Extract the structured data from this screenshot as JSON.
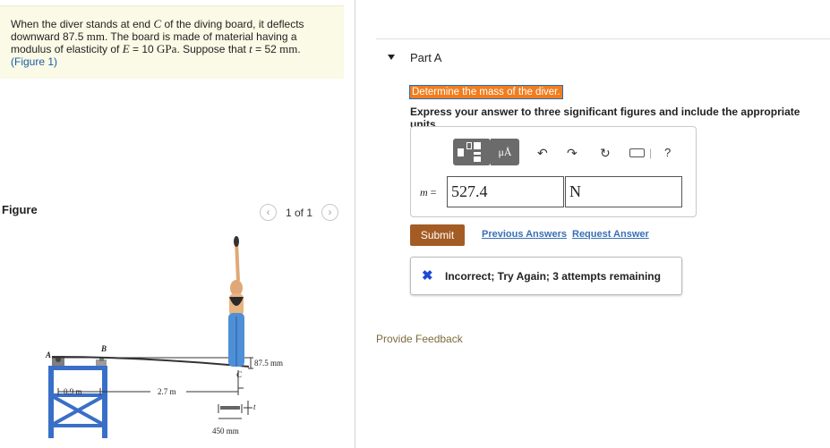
{
  "problem": {
    "line1_pre": "When the diver stands at end ",
    "line1_var": "C",
    "line1_post": " of the diving board, it deflects",
    "line2_pre": "downward 87.5 ",
    "line2_unit": "mm",
    "line2_post": ". The board is made of material having a",
    "line3_pre": "modulus of elasticity of ",
    "line3_var": "E",
    "line3_mid": " = 10 ",
    "line3_unit": "GPa",
    "line3_post": ". Suppose that ",
    "line3_var2": "t",
    "line3_post2": " = 52 ",
    "line3_unit2": "mm",
    "line3_end": ".",
    "figure_link": "(Figure 1)"
  },
  "figure": {
    "label": "Figure",
    "pager_text": "1 of 1",
    "prev_icon": "chevron-left-icon",
    "next_icon": "chevron-right-icon",
    "labels": {
      "A": "A",
      "B": "B",
      "C": "C",
      "deflection": "87.5 mm",
      "dim_left": "0.9 m",
      "dim_right": "2.7 m",
      "width": "450 mm",
      "thickness": "t"
    }
  },
  "part": {
    "title": "Part A",
    "question": "Determine the mass of the diver.",
    "instructions": "Express your answer to three significant figures and include the appropriate units."
  },
  "answer": {
    "variable": "m",
    "equals": " =",
    "value": "527.4",
    "unit": "N",
    "toolbar_mu": "μÅ",
    "icons": [
      "templates-icon",
      "units-icon",
      "undo-icon",
      "redo-icon",
      "reset-icon",
      "keyboard-icon",
      "help-icon"
    ],
    "help": "?"
  },
  "actions": {
    "submit": "Submit",
    "previous": "Previous Answers",
    "request": "Request Answer"
  },
  "feedback": {
    "text": "Incorrect; Try Again; 3 attempts remaining",
    "icon": "x-icon"
  },
  "provide_feedback": "Provide Feedback",
  "colors": {
    "question_bg": "#f07d1f",
    "submit_bg": "#a35c24",
    "link": "#3a6fb4",
    "incorrect_icon": "#1c4ad6",
    "problem_bg": "#fafae6"
  }
}
